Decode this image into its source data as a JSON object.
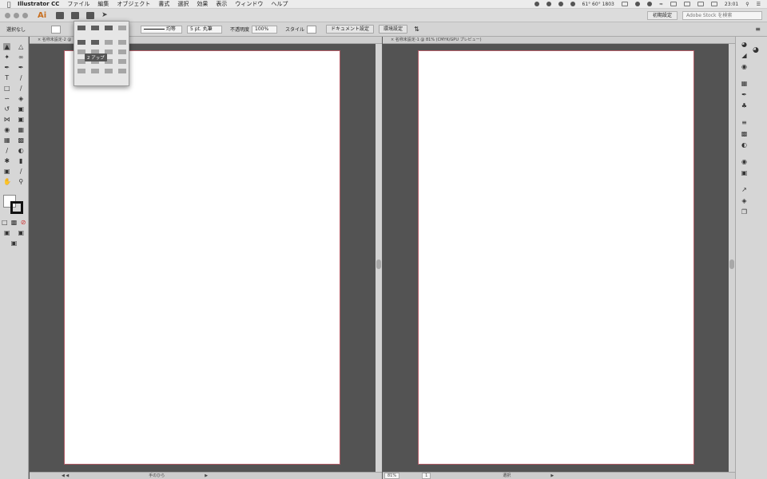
{
  "menubar": {
    "app_name": "Illustrator CC",
    "items": [
      "ファイル",
      "編集",
      "オブジェクト",
      "書式",
      "選択",
      "効果",
      "表示",
      "ウィンドウ",
      "ヘルプ"
    ],
    "status_temps": "61° 60° 1803",
    "clock": "23:01"
  },
  "appbar": {
    "logo": "Ai",
    "workspace": "初期設定",
    "stock_placeholder": "Adobe Stock を検索"
  },
  "controlbar": {
    "selection": "選択なし",
    "stroke_style": "均等",
    "brush": "5 pt. 丸筆",
    "opacity_label": "不透明度",
    "opacity_value": "100%",
    "style_label": "スタイル",
    "doc_setup_btn": "ドキュメント設定",
    "prefs_btn": "環境設定"
  },
  "arrange_popup": {
    "tooltip": "2 アップ"
  },
  "documents": [
    {
      "tab": "名称未設定-2 @",
      "status_left": "",
      "status_mode": "手のひら"
    },
    {
      "tab": "名称未設定-1 @ 81% (CMYK/GPU プレビュー)",
      "status_zoom": "81%",
      "status_page": "1",
      "status_mode": "選択"
    }
  ]
}
